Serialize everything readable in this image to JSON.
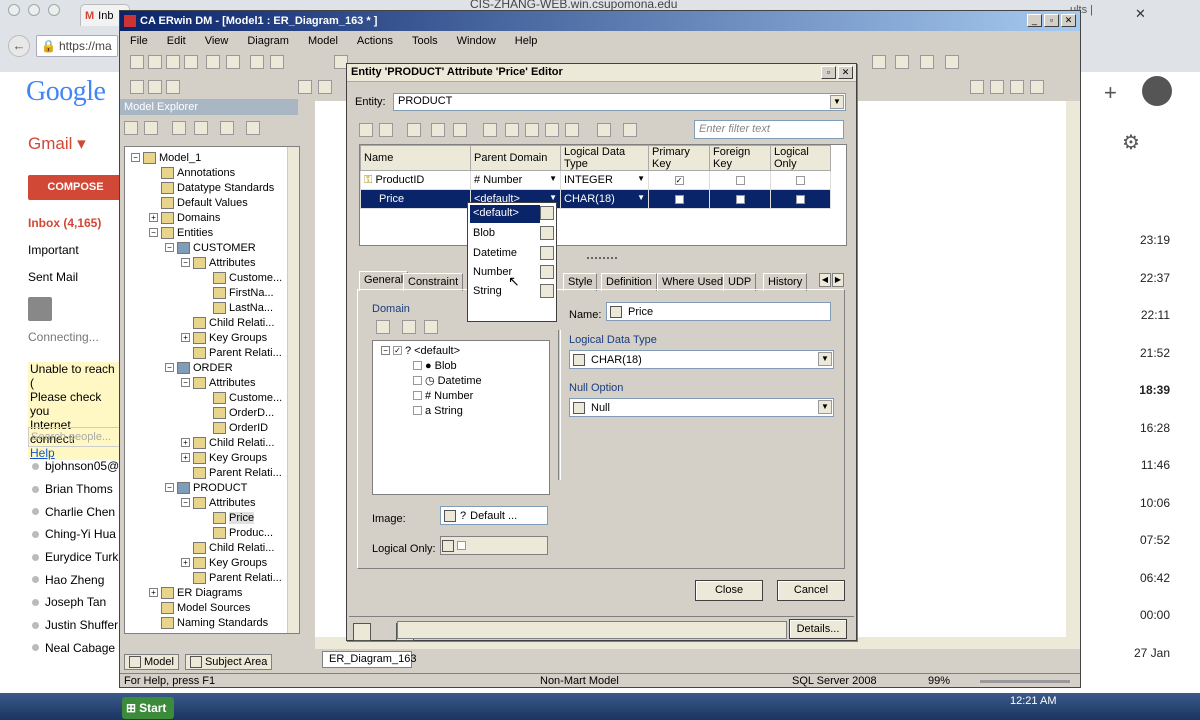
{
  "chrome": {
    "tab_label": "Inb",
    "window_host": "CIS-ZHANG-WEB.win.csupomona.edu",
    "tab2_label": "ults |",
    "address": "https://ma"
  },
  "gmail": {
    "logo": "Google",
    "label": "Gmail ▾",
    "compose": "COMPOSE",
    "nav": [
      "Inbox (4,165)",
      "Important",
      "Sent Mail"
    ],
    "connecting": "Connecting...",
    "warning": [
      "Unable to reach (",
      "Please check you",
      "Internet connecti",
      "Help"
    ],
    "search_placeholder": "Search people...",
    "contacts": [
      "bjohnson05@",
      "Brian Thoms",
      "Charlie Chen",
      "Ching-Yi Hua",
      "Eurydice Turk",
      "Hao Zheng",
      "Joseph Tan",
      "Justin Shuffer",
      "Neal Cabage"
    ],
    "times": [
      "23:19",
      "22:37",
      "22:11",
      "21:52",
      "18:39",
      "16:28",
      "11:46",
      "10:06",
      "07:52",
      "06:42",
      "00:00",
      "27 Jan"
    ]
  },
  "erwin": {
    "title": "CA ERwin DM - [Model1 : ER_Diagram_163 * ]",
    "menu": [
      "File",
      "Edit",
      "View",
      "Diagram",
      "Model",
      "Actions",
      "Tools",
      "Window",
      "Help"
    ],
    "model_explorer_title": "Model Explorer",
    "tree": [
      {
        "label": "Model_1",
        "level": 0,
        "exp": "-"
      },
      {
        "label": "Annotations",
        "level": 1,
        "exp": ""
      },
      {
        "label": "Datatype Standards",
        "level": 1,
        "exp": ""
      },
      {
        "label": "Default Values",
        "level": 1,
        "exp": ""
      },
      {
        "label": "Domains",
        "level": 1,
        "exp": "+"
      },
      {
        "label": "Entities",
        "level": 1,
        "exp": "-"
      },
      {
        "label": "CUSTOMER",
        "level": 2,
        "exp": "-"
      },
      {
        "label": "Attributes",
        "level": 3,
        "exp": "-"
      },
      {
        "label": "Custome...",
        "level": 4,
        "exp": ""
      },
      {
        "label": "FirstNa...",
        "level": 4,
        "exp": ""
      },
      {
        "label": "LastNa...",
        "level": 4,
        "exp": ""
      },
      {
        "label": "Child Relati...",
        "level": 3,
        "exp": ""
      },
      {
        "label": "Key Groups",
        "level": 3,
        "exp": "+"
      },
      {
        "label": "Parent Relati...",
        "level": 3,
        "exp": ""
      },
      {
        "label": "ORDER",
        "level": 2,
        "exp": "-"
      },
      {
        "label": "Attributes",
        "level": 3,
        "exp": "-"
      },
      {
        "label": "Custome...",
        "level": 4,
        "exp": ""
      },
      {
        "label": "OrderD...",
        "level": 4,
        "exp": ""
      },
      {
        "label": "OrderID",
        "level": 4,
        "exp": ""
      },
      {
        "label": "Child Relati...",
        "level": 3,
        "exp": "+"
      },
      {
        "label": "Key Groups",
        "level": 3,
        "exp": "+"
      },
      {
        "label": "Parent Relati...",
        "level": 3,
        "exp": ""
      },
      {
        "label": "PRODUCT",
        "level": 2,
        "exp": "-"
      },
      {
        "label": "Attributes",
        "level": 3,
        "exp": "-"
      },
      {
        "label": "Price",
        "level": 4,
        "exp": ""
      },
      {
        "label": "Produc...",
        "level": 4,
        "exp": ""
      },
      {
        "label": "Child Relati...",
        "level": 3,
        "exp": ""
      },
      {
        "label": "Key Groups",
        "level": 3,
        "exp": "+"
      },
      {
        "label": "Parent Relati...",
        "level": 3,
        "exp": ""
      },
      {
        "label": "ER Diagrams",
        "level": 1,
        "exp": "+"
      },
      {
        "label": "Model Sources",
        "level": 1,
        "exp": ""
      },
      {
        "label": "Naming Standards",
        "level": 1,
        "exp": ""
      }
    ],
    "me_tabs": [
      "Model",
      "Subject Area"
    ],
    "diagram_tab": "ER_Diagram_163",
    "status": {
      "help": "For Help, press F1",
      "mart": "Non-Mart Model",
      "db": "SQL Server 2008",
      "zoom": "99%"
    }
  },
  "dialog": {
    "title": "Entity 'PRODUCT' Attribute 'Price' Editor",
    "entity_label": "Entity:",
    "entity_value": "PRODUCT",
    "filter_placeholder": "Enter filter text",
    "columns": [
      "Name",
      "Parent Domain",
      "Logical Data Type",
      "Primary Key",
      "Foreign Key",
      "Logical Only"
    ],
    "rows": [
      {
        "name": "ProductID",
        "domain": "Number",
        "type": "INTEGER",
        "pk": true,
        "fk": false,
        "lo": false
      },
      {
        "name": "Price",
        "domain": "<default>",
        "type": "CHAR(18)",
        "pk": false,
        "fk": false,
        "lo": false
      }
    ],
    "dropdown_options": [
      "<default>",
      "Blob",
      "Datetime",
      "Number",
      "String"
    ],
    "tabs": [
      "General",
      "Constraint",
      "Style",
      "Definition",
      "Where Used",
      "UDP",
      "History"
    ],
    "domain_label": "Domain",
    "domain_tree": [
      "<default>",
      "Blob",
      "Datetime",
      "Number",
      "String"
    ],
    "image_label": "Image:",
    "image_value": "Default ...",
    "logical_only_label": "Logical Only:",
    "name_label": "Name:",
    "name_value": "Price",
    "ldt_label": "Logical Data Type",
    "ldt_value": "CHAR(18)",
    "null_label": "Null Option",
    "null_value": "Null",
    "close": "Close",
    "cancel": "Cancel",
    "details": "Details..."
  },
  "taskbar": {
    "start": "Start",
    "time": "12:21 AM"
  },
  "colors": {
    "title_bar": "#0a246a",
    "gmail_red": "#d14836",
    "dialog_bg": "#d4d0c8"
  }
}
